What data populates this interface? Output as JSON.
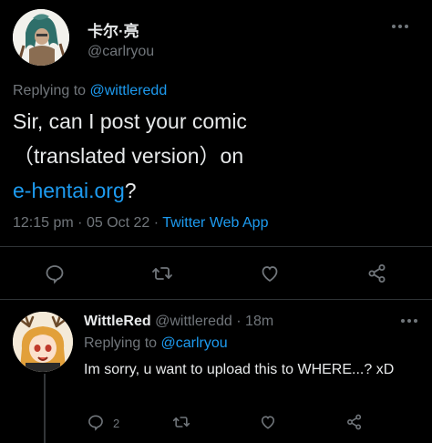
{
  "main_tweet": {
    "display_name": "卡尔·亮",
    "handle": "@carlryou",
    "replying_prefix": "Replying to",
    "replying_to": "@wittleredd",
    "text_line1": "Sir, can I post your comic",
    "text_line2": "（translated version）on",
    "text_link": "e-hentai.org",
    "text_end": "?",
    "time": "12:15 pm",
    "date": "05 Oct 22",
    "separator": "·",
    "source": "Twitter Web App"
  },
  "reply_tweet": {
    "display_name": "WittleRed",
    "handle": "@wittleredd",
    "separator": "·",
    "age": "18m",
    "replying_prefix": "Replying to",
    "replying_to": "@carlryou",
    "text": "Im sorry, u want to upload this to WHERE...? xD",
    "reply_count": "2"
  },
  "icons": [
    "reply-icon",
    "retweet-icon",
    "like-icon",
    "share-icon",
    "more-icon"
  ],
  "colors": {
    "background": "#000000",
    "text": "#e7e9ea",
    "secondary": "#71767b",
    "link": "#1d9bf0",
    "divider": "#2f3336"
  }
}
